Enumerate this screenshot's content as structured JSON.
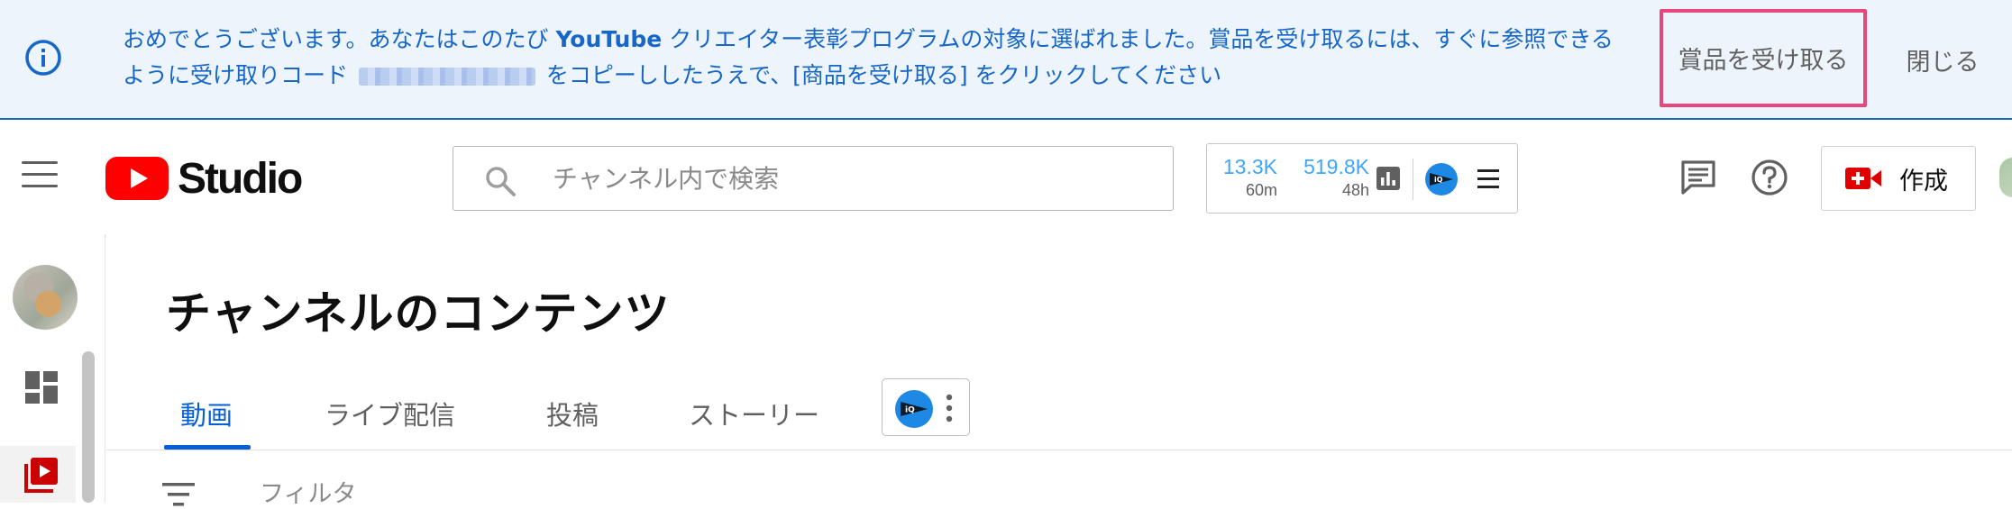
{
  "banner": {
    "message_prefix": "おめでとうございます。あなたはこのたび",
    "brand": "YouTube",
    "message_mid": "クリエイター表彰プログラムの対象に選ばれました。賞品を受け取るには、すぐに参照できるように受け取りコード",
    "message_suffix": "をコピーししたうえで、[商品を受け取る] をクリックしてください",
    "claim_label": "賞品を受け取る",
    "close_label": "閉じる",
    "accent_color": "#1667c9",
    "highlight_color": "#e8477b"
  },
  "header": {
    "logo_text": "Studio",
    "search_placeholder": "チャンネル内で検索",
    "stats": [
      {
        "value": "13.3K",
        "period": "60m"
      },
      {
        "value": "519.8K",
        "period": "48h"
      }
    ],
    "create_label": "作成"
  },
  "main": {
    "page_title": "チャンネルのコンテンツ",
    "tabs": [
      {
        "label": "動画",
        "active": true
      },
      {
        "label": "ライブ配信",
        "active": false
      },
      {
        "label": "投稿",
        "active": false
      },
      {
        "label": "ストーリー",
        "active": false
      }
    ],
    "filter_label": "フィルタ"
  },
  "icons": {
    "banner": "info-icon",
    "header": [
      "hamburger-menu-icon",
      "youtube-logo-icon",
      "search-icon",
      "bar-chart-icon",
      "iq-badge-icon",
      "menu-icon",
      "comment-icon",
      "help-icon",
      "create-video-icon"
    ],
    "sidebar": [
      "dashboard-icon",
      "content-icon"
    ],
    "tabs": [
      "iq-extension-icon",
      "more-vert-icon"
    ],
    "filter": "filter-icon"
  }
}
